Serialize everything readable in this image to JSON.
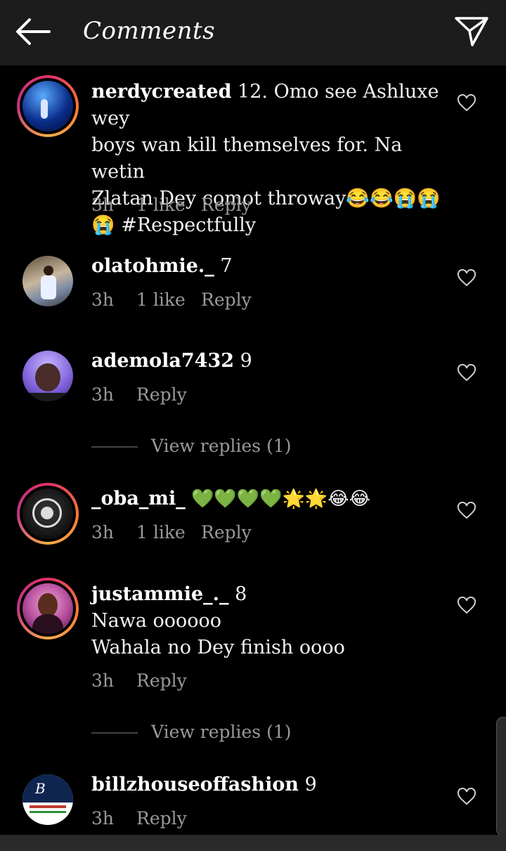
{
  "header": {
    "title": "Comments"
  },
  "comments": [
    {
      "username": "nerdycreated",
      "text_line1": " 12. Omo see Ashluxe wey",
      "text_line2": "boys wan kill themselves for. Na wetin",
      "text_line3": "Zlatan Dey comot throway😂😂😭😭",
      "text_line4": "😭 #Respectfully",
      "time": "3h",
      "likes": "1 like",
      "reply": "Reply"
    },
    {
      "username": "olatohmie._",
      "text": " 7",
      "time": "3h",
      "likes": "1 like",
      "reply": "Reply"
    },
    {
      "username": "ademola7432",
      "text": " 9",
      "time": "3h",
      "reply": "Reply",
      "view_replies": "View replies (1)"
    },
    {
      "username": "_oba_mi_",
      "text": " 💚💚💚💚🌟🌟😂😂",
      "time": "3h",
      "likes": "1 like",
      "reply": "Reply"
    },
    {
      "username": "justammie_._",
      "text": " 8",
      "text_line2": "Nawa oooooo",
      "text_line3": "Wahala no Dey finish oooo",
      "time": "3h",
      "reply": "Reply",
      "view_replies": "View replies (1)"
    },
    {
      "username": "billzhouseoffashion",
      "text": " 9",
      "time": "3h",
      "reply": "Reply"
    }
  ],
  "colors": {
    "background": "#000000",
    "topbar": "#1c1c1c",
    "meta_text": "#9a9a9a",
    "story_ring": "#e1306c"
  },
  "icons": [
    "back-arrow-icon",
    "send-icon",
    "heart-icon"
  ]
}
